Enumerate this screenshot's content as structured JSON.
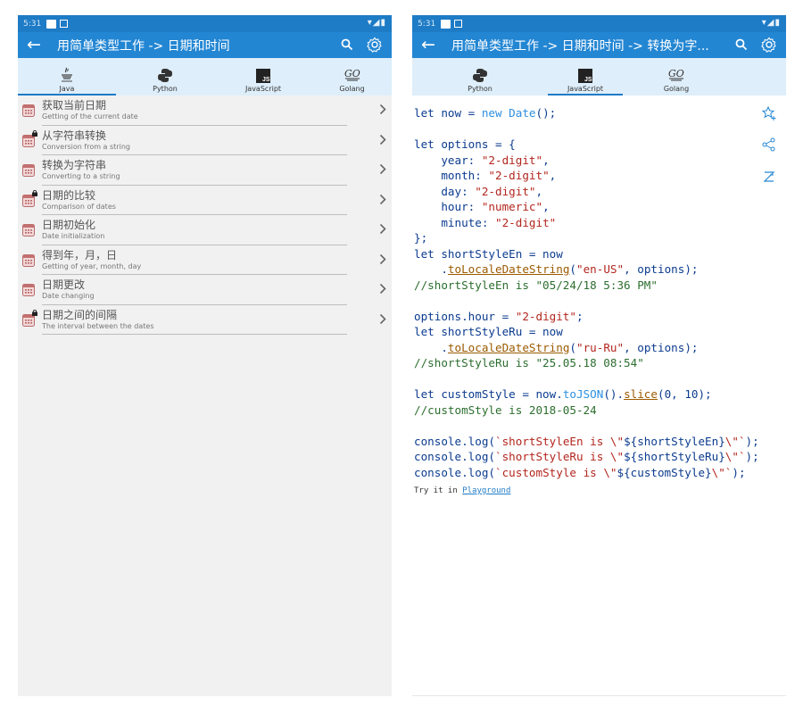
{
  "status": {
    "time": "5:31"
  },
  "left": {
    "title": "用简单类型工作 -> 日期和时间",
    "tabs": [
      {
        "label": "Java",
        "icon": "java-icon"
      },
      {
        "label": "Python",
        "icon": "python-icon"
      },
      {
        "label": "JavaScript",
        "icon": "javascript-icon"
      },
      {
        "label": "Golang",
        "icon": "golang-icon"
      }
    ],
    "items": [
      {
        "title": "获取当前日期",
        "subtitle": "Getting of the current date"
      },
      {
        "title": "从字符串转换",
        "subtitle": "Conversion from a string"
      },
      {
        "title": "转换为字符串",
        "subtitle": "Converting to a string"
      },
      {
        "title": "日期的比较",
        "subtitle": "Comparison of dates"
      },
      {
        "title": "日期初始化",
        "subtitle": "Date initialization"
      },
      {
        "title": "得到年，月，日",
        "subtitle": "Getting of year, month, day"
      },
      {
        "title": "日期更改",
        "subtitle": "Date changing"
      },
      {
        "title": "日期之间的间隔",
        "subtitle": "The interval between the dates"
      }
    ]
  },
  "right": {
    "title": "用简单类型工作 -> 日期和时间 -> 转换为字...",
    "tabs": [
      {
        "label": "Python",
        "icon": "python-icon"
      },
      {
        "label": "JavaScript",
        "icon": "javascript-icon"
      },
      {
        "label": "Golang",
        "icon": "golang-icon"
      }
    ],
    "code": {
      "l1a": "let now = ",
      "l1b": "new Date",
      "l1c": "();",
      "l3": "let options = {",
      "year_k": "    year: ",
      "year_v": "\"2-digit\"",
      "comma": ",",
      "month_k": "    month: ",
      "month_v": "\"2-digit\"",
      "day_k": "    day: ",
      "day_v": "\"2-digit\"",
      "hour_k": "    hour: ",
      "hour_v": "\"numeric\"",
      "minute_k": "    minute: ",
      "minute_v": "\"2-digit\"",
      "close": "};",
      "en1": "let shortStyleEn = now",
      "en2a": "    .",
      "en2b": "toLocaleDateString",
      "en2c": "(",
      "en2d": "\"en-US\"",
      "en2e": ", options);",
      "en3": "//shortStyleEn is \"05/24/18 5:36 PM\"",
      "oh1a": "options.hour = ",
      "oh1b": "\"2-digit\"",
      "oh1c": ";",
      "ru1": "let shortStyleRu = now",
      "ru2a": "    .",
      "ru2b": "toLocaleDateString",
      "ru2c": "(",
      "ru2d": "\"ru-Ru\"",
      "ru2e": ", options);",
      "ru3": "//shortStyleRu is \"25.05.18 08:54\"",
      "cs1a": "let customStyle = now.",
      "cs1b": "toJSON",
      "cs1c": "().",
      "cs1d": "slice",
      "cs1e": "(0, 10);",
      "cs2": "//customStyle is 2018-05-24",
      "log1a": "console.log(",
      "log1b": "`shortStyleEn is \\\"",
      "log1c": "${shortStyleEn}",
      "log1d": "\\\"`",
      "log1e": ");",
      "log2a": "console.log(",
      "log2b": "`shortStyleRu is \\\"",
      "log2c": "${shortStyleRu}",
      "log2d": "\\\"`",
      "log2e": ");",
      "log3a": "console.log(",
      "log3b": "`customStyle is \\\"",
      "log3c": "${customStyle}",
      "log3d": "\\\"`",
      "log3e": ");"
    },
    "playground_prefix": "Try it in ",
    "playground_link": "Playground"
  }
}
